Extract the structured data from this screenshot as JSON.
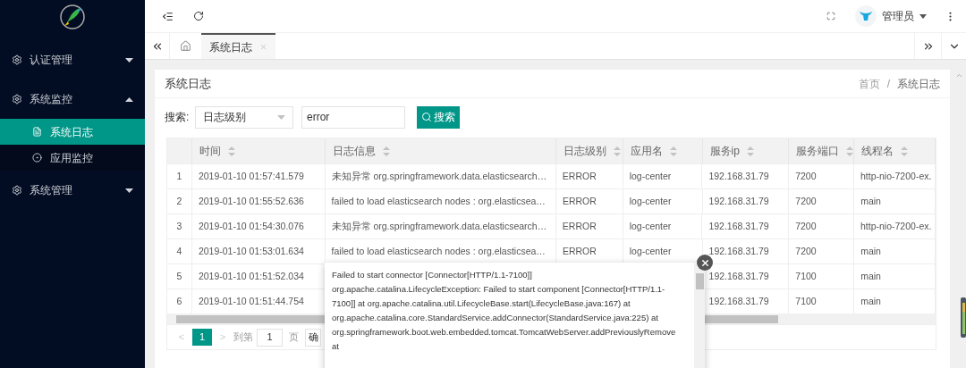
{
  "sidebar": {
    "items": [
      {
        "label": "认证管理",
        "expanded": false
      },
      {
        "label": "系统监控",
        "expanded": true,
        "children": [
          {
            "label": "系统日志",
            "selected": true
          },
          {
            "label": "应用监控",
            "selected": false
          }
        ]
      },
      {
        "label": "系统管理",
        "expanded": false
      }
    ]
  },
  "header": {
    "user": "管理员"
  },
  "tabs": [
    {
      "label": "系统日志",
      "selected": true
    }
  ],
  "page": {
    "title": "系统日志",
    "breadcrumb": [
      "首页",
      "系统日志"
    ],
    "breadcrumb_separator": "/"
  },
  "search": {
    "label": "搜索:",
    "select": "日志级别",
    "value": "error",
    "button": "搜索"
  },
  "table": {
    "columns": [
      "",
      "时间",
      "日志信息",
      "日志级别",
      "应用名",
      "服务ip",
      "服务端口",
      "线程名"
    ],
    "rows": [
      [
        "1",
        "2019-01-10 01:57:41.579",
        "未知异常 org.springframework.data.elasticsearch…",
        "ERROR",
        "log-center",
        "192.168.31.79",
        "7200",
        "http-nio-7200-ex."
      ],
      [
        "2",
        "2019-01-10 01:55:52.636",
        "failed to load elasticsearch nodes : org.elasticsea…",
        "ERROR",
        "log-center",
        "192.168.31.79",
        "7200",
        "main"
      ],
      [
        "3",
        "2019-01-10 01:54:30.076",
        "未知异常 org.springframework.data.elasticsearch…",
        "ERROR",
        "log-center",
        "192.168.31.79",
        "7200",
        "http-nio-7200-ex."
      ],
      [
        "4",
        "2019-01-10 01:53:01.634",
        "failed to load elasticsearch nodes : org.elasticsea…",
        "ERROR",
        "log-center",
        "192.168.31.79",
        "7200",
        "main"
      ],
      [
        "5",
        "2019-01-10 01:51:52.034",
        null,
        null,
        null,
        "192.168.31.79",
        "7100",
        "main"
      ],
      [
        "6",
        "2019-01-10 01:51:44.754",
        null,
        null,
        null,
        "192.168.31.79",
        "7100",
        "main"
      ]
    ]
  },
  "pagination": {
    "prev": "<",
    "pages": [
      {
        "label": "1",
        "selected": true
      }
    ],
    "next": ">",
    "goto": "到第",
    "page_input": "1",
    "page_unit": "页",
    "confirm": "确"
  },
  "popup": {
    "lines": [
      "Failed to start connector [Connector[HTTP/1.1-7100]]",
      "org.apache.catalina.LifecycleException: Failed to start component [Connector[HTTP/1.1-",
      "7100]] at org.apache.catalina.util.LifecycleBase.start(LifecycleBase.java:167) at",
      "org.apache.catalina.core.StandardService.addConnector(StandardService.java:225) at",
      "org.springframework.boot.web.embedded.tomcat.TomcatWebServer.addPreviouslyRemove",
      "at"
    ]
  }
}
